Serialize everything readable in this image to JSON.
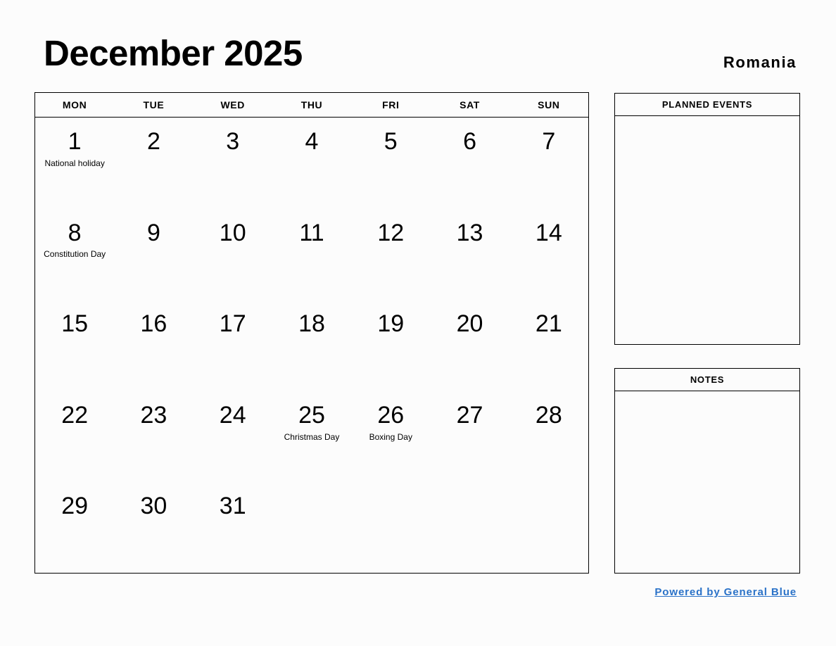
{
  "header": {
    "month_title": "December 2025",
    "country": "Romania"
  },
  "calendar": {
    "weekdays": [
      "MON",
      "TUE",
      "WED",
      "THU",
      "FRI",
      "SAT",
      "SUN"
    ],
    "weeks": [
      [
        {
          "day": "1",
          "event": "National holiday"
        },
        {
          "day": "2",
          "event": ""
        },
        {
          "day": "3",
          "event": ""
        },
        {
          "day": "4",
          "event": ""
        },
        {
          "day": "5",
          "event": ""
        },
        {
          "day": "6",
          "event": ""
        },
        {
          "day": "7",
          "event": ""
        }
      ],
      [
        {
          "day": "8",
          "event": "Constitution Day"
        },
        {
          "day": "9",
          "event": ""
        },
        {
          "day": "10",
          "event": ""
        },
        {
          "day": "11",
          "event": ""
        },
        {
          "day": "12",
          "event": ""
        },
        {
          "day": "13",
          "event": ""
        },
        {
          "day": "14",
          "event": ""
        }
      ],
      [
        {
          "day": "15",
          "event": ""
        },
        {
          "day": "16",
          "event": ""
        },
        {
          "day": "17",
          "event": ""
        },
        {
          "day": "18",
          "event": ""
        },
        {
          "day": "19",
          "event": ""
        },
        {
          "day": "20",
          "event": ""
        },
        {
          "day": "21",
          "event": ""
        }
      ],
      [
        {
          "day": "22",
          "event": ""
        },
        {
          "day": "23",
          "event": ""
        },
        {
          "day": "24",
          "event": ""
        },
        {
          "day": "25",
          "event": "Christmas Day"
        },
        {
          "day": "26",
          "event": "Boxing Day"
        },
        {
          "day": "27",
          "event": ""
        },
        {
          "day": "28",
          "event": ""
        }
      ],
      [
        {
          "day": "29",
          "event": ""
        },
        {
          "day": "30",
          "event": ""
        },
        {
          "day": "31",
          "event": ""
        },
        {
          "day": "",
          "event": ""
        },
        {
          "day": "",
          "event": ""
        },
        {
          "day": "",
          "event": ""
        },
        {
          "day": "",
          "event": ""
        }
      ]
    ]
  },
  "panels": {
    "planned_events_title": "PLANNED EVENTS",
    "notes_title": "NOTES"
  },
  "footer": {
    "link_label": "Powered by General Blue",
    "link_color": "#2a72c8"
  }
}
